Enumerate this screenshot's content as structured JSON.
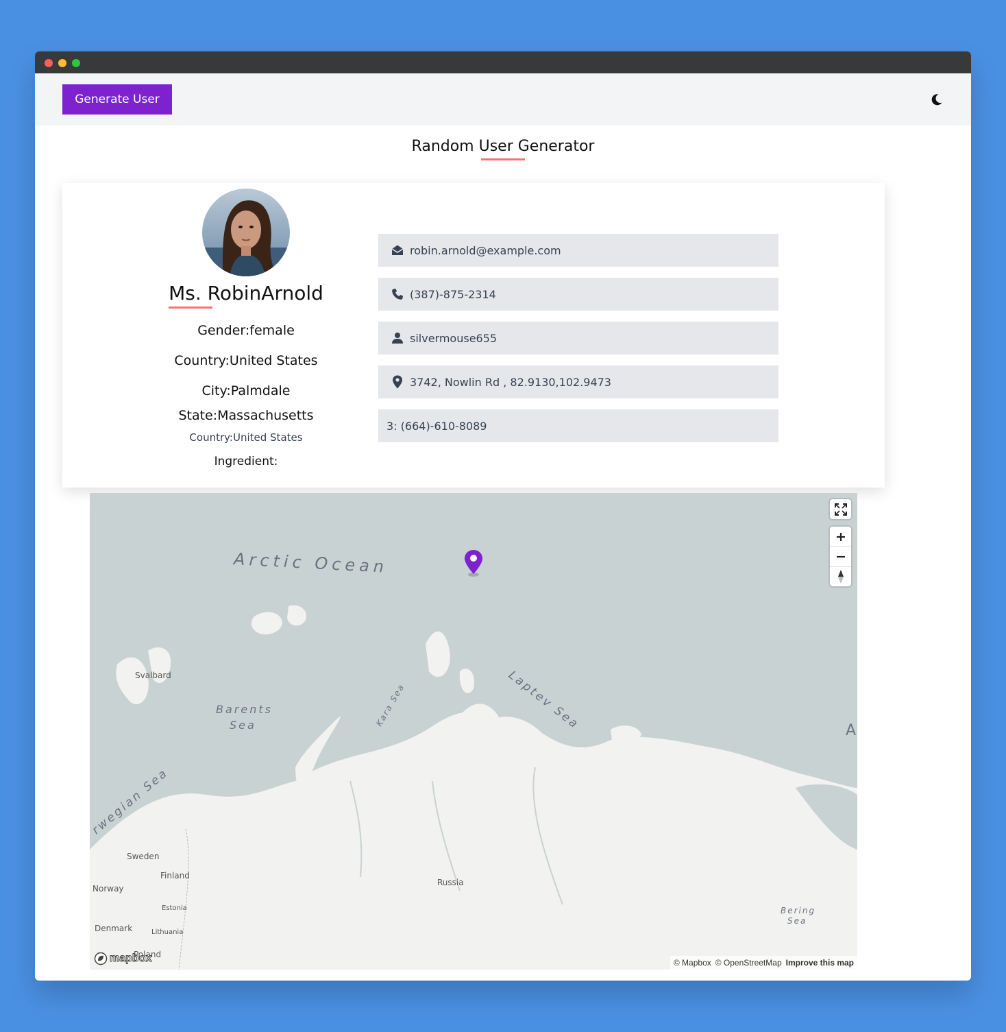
{
  "navbar": {
    "generate_button": "Generate User",
    "theme_toggle_icon": "moon-icon"
  },
  "page": {
    "title": "Random User Generator"
  },
  "user": {
    "name": "Ms. RobinArnold",
    "gender_label": "Gender:",
    "gender": "female",
    "country_label": "Country:",
    "country": "United States",
    "city_label": "City:",
    "city": "Palmdale",
    "state_label": "State:",
    "state": "Massachusetts",
    "country2_label": "Country:",
    "country2": "United States",
    "ingredient_label": "Ingredient:",
    "ingredient": ""
  },
  "contacts": [
    {
      "icon": "envelope-icon",
      "text": "robin.arnold@example.com"
    },
    {
      "icon": "phone-icon",
      "text": "(387)-875-2314"
    },
    {
      "icon": "user-icon",
      "text": "silvermouse655"
    },
    {
      "icon": "map-pin-icon",
      "text": "3742, Nowlin Rd , 82.9130,102.9473"
    },
    {
      "icon": "",
      "text": "3: (664)-610-8089"
    }
  ],
  "map": {
    "labels": {
      "arctic_ocean": "Arctic Ocean",
      "svalbard": "Svalbard",
      "barents_sea_1": "Barents",
      "barents_sea_2": "Sea",
      "kara_sea": "Kara Sea",
      "laptev_sea": "Laptev Sea",
      "norwegian_sea": "rwegian Sea",
      "sweden": "Sweden",
      "finland": "Finland",
      "norway": "Norway",
      "estonia": "Estonia",
      "denmark": "Denmark",
      "lithuania": "Lithuania",
      "poland": "Poland",
      "russia": "Russia",
      "bering_sea_1": "Bering",
      "bering_sea_2": "Sea",
      "edge_letter": "A"
    },
    "attribution": {
      "mapbox": "© Mapbox",
      "osm": "© OpenStreetMap",
      "improve": "Improve this map"
    },
    "logo": "mapbox",
    "marker_color": "#7e22ce"
  },
  "colors": {
    "accent": "#7e22ce",
    "underline": "#f87171",
    "background": "#4a90e2",
    "row_bg": "#e5e7eb"
  }
}
